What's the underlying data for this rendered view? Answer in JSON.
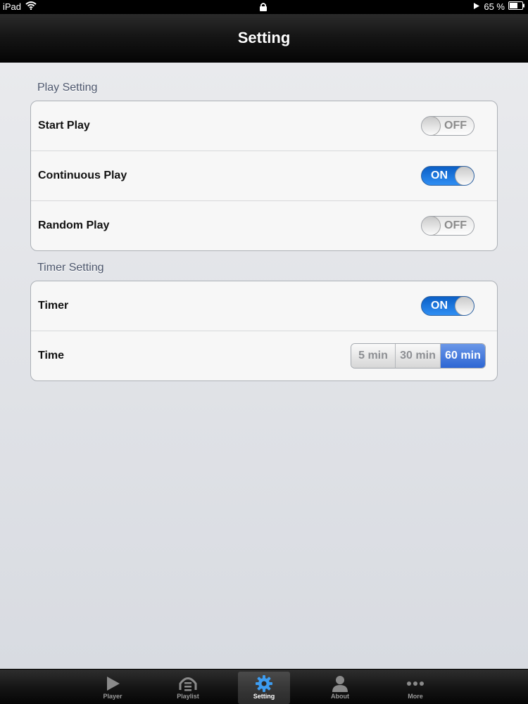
{
  "status_bar": {
    "device": "iPad",
    "battery": "65 %"
  },
  "nav": {
    "title": "Setting"
  },
  "play_setting": {
    "header": "Play Setting",
    "rows": [
      {
        "label": "Start Play",
        "switch": "OFF"
      },
      {
        "label": "Continuous Play",
        "switch": "ON"
      },
      {
        "label": "Random Play",
        "switch": "OFF"
      }
    ]
  },
  "timer_setting": {
    "header": "Timer Setting",
    "timer": {
      "label": "Timer",
      "switch": "ON"
    },
    "time": {
      "label": "Time",
      "options": [
        "5 min",
        "30 min",
        "60 min"
      ],
      "selected": "60 min"
    }
  },
  "tab_bar": {
    "tabs": [
      {
        "label": "Player",
        "icon": "play-icon"
      },
      {
        "label": "Playlist",
        "icon": "playlist-icon"
      },
      {
        "label": "Setting",
        "icon": "gear-icon"
      },
      {
        "label": "About",
        "icon": "person-icon"
      },
      {
        "label": "More",
        "icon": "more-icon"
      }
    ],
    "selected": "Setting"
  },
  "colors": {
    "switch_on": "#1a73e0",
    "segment_selected": "#3a70d8",
    "active_tab_icon": "#3d9cf0"
  }
}
